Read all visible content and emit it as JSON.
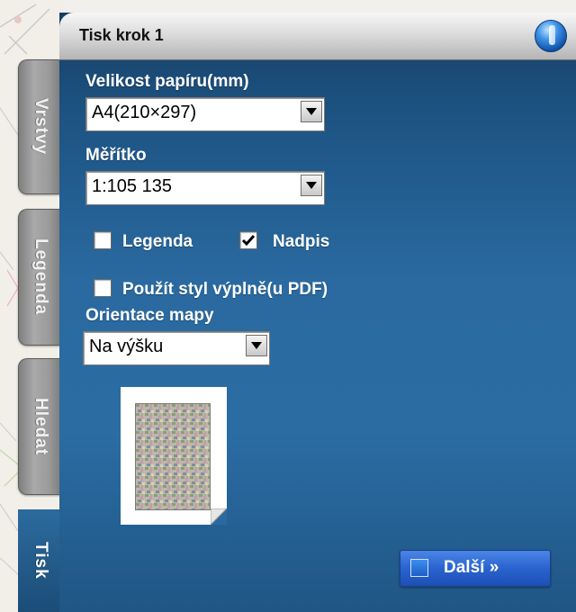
{
  "window": {
    "title": "Tisk krok 1"
  },
  "side_tabs": [
    {
      "label": "Vrstvy",
      "active": false
    },
    {
      "label": "Legenda",
      "active": false
    },
    {
      "label": "Hledat",
      "active": false
    },
    {
      "label": "Tisk",
      "active": true
    }
  ],
  "form": {
    "paper_size_label": "Velikost papíru(mm)",
    "paper_size_value": "A4(210×297)",
    "scale_label": "Měřítko",
    "scale_value": "1:105 135",
    "legend_checkbox": {
      "label": "Legenda",
      "checked": false
    },
    "caption_checkbox": {
      "label": "Nadpis",
      "checked": true
    },
    "fill_style_checkbox": {
      "label": "Použít styl výplně(u PDF)",
      "checked": false
    },
    "orientation_label": "Orientace mapy",
    "orientation_value": "Na výšku"
  },
  "preview": {
    "icon": "portrait-page-preview"
  },
  "next_button": {
    "label": "Další »"
  },
  "colors": {
    "panel_blue": "#2a6aa0",
    "button_blue": "#2a63cf",
    "tab_gray": "#9a9a9a"
  }
}
